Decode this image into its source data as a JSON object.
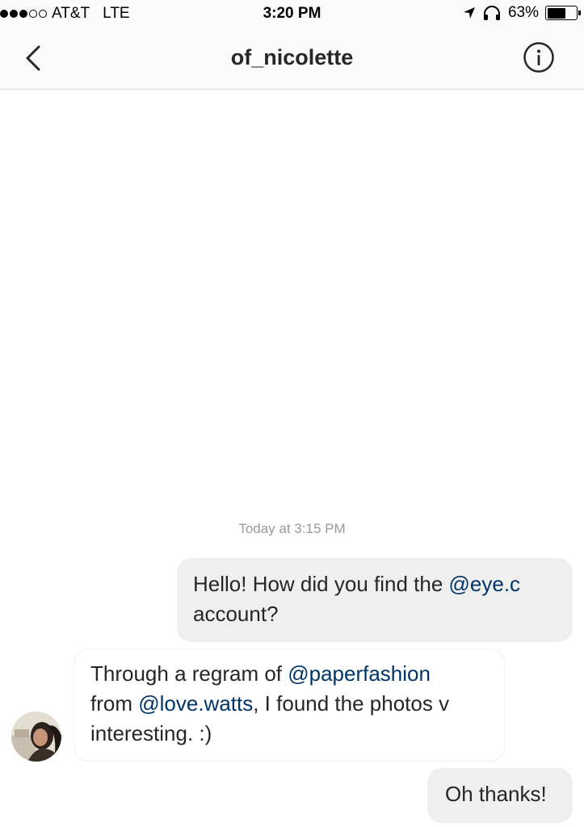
{
  "status_bar": {
    "carrier": "AT&T",
    "network": "LTE",
    "time": "3:20 PM",
    "battery_percent": "63%",
    "battery_level": 0.63,
    "signal_filled": 3,
    "signal_total": 5
  },
  "header": {
    "title": "of_nicolette",
    "back_icon": "chevron-left-icon",
    "info_icon": "info-circle-icon"
  },
  "thread": {
    "timestamp": "Today at 3:15 PM",
    "messages": [
      {
        "direction": "outgoing",
        "parts": [
          {
            "text": "Hello! How did you find the ",
            "mention": false
          },
          {
            "text": "@eye.c",
            "mention": true
          },
          {
            "text": " account?",
            "mention": false
          }
        ]
      },
      {
        "direction": "incoming",
        "parts": [
          {
            "text": "Through a regram of ",
            "mention": false
          },
          {
            "text": "@paperfashion",
            "mention": true
          },
          {
            "text": " from ",
            "mention": false
          },
          {
            "text": "@love.watts",
            "mention": true
          },
          {
            "text": ", I found the photos v interesting. :)",
            "mention": false
          }
        ]
      },
      {
        "direction": "outgoing",
        "parts": [
          {
            "text": "Oh thanks!",
            "mention": false
          }
        ]
      }
    ]
  },
  "colors": {
    "mention": "#003569",
    "outgoing_bubble": "#efefef",
    "timestamp": "#999999",
    "text": "#262626"
  }
}
